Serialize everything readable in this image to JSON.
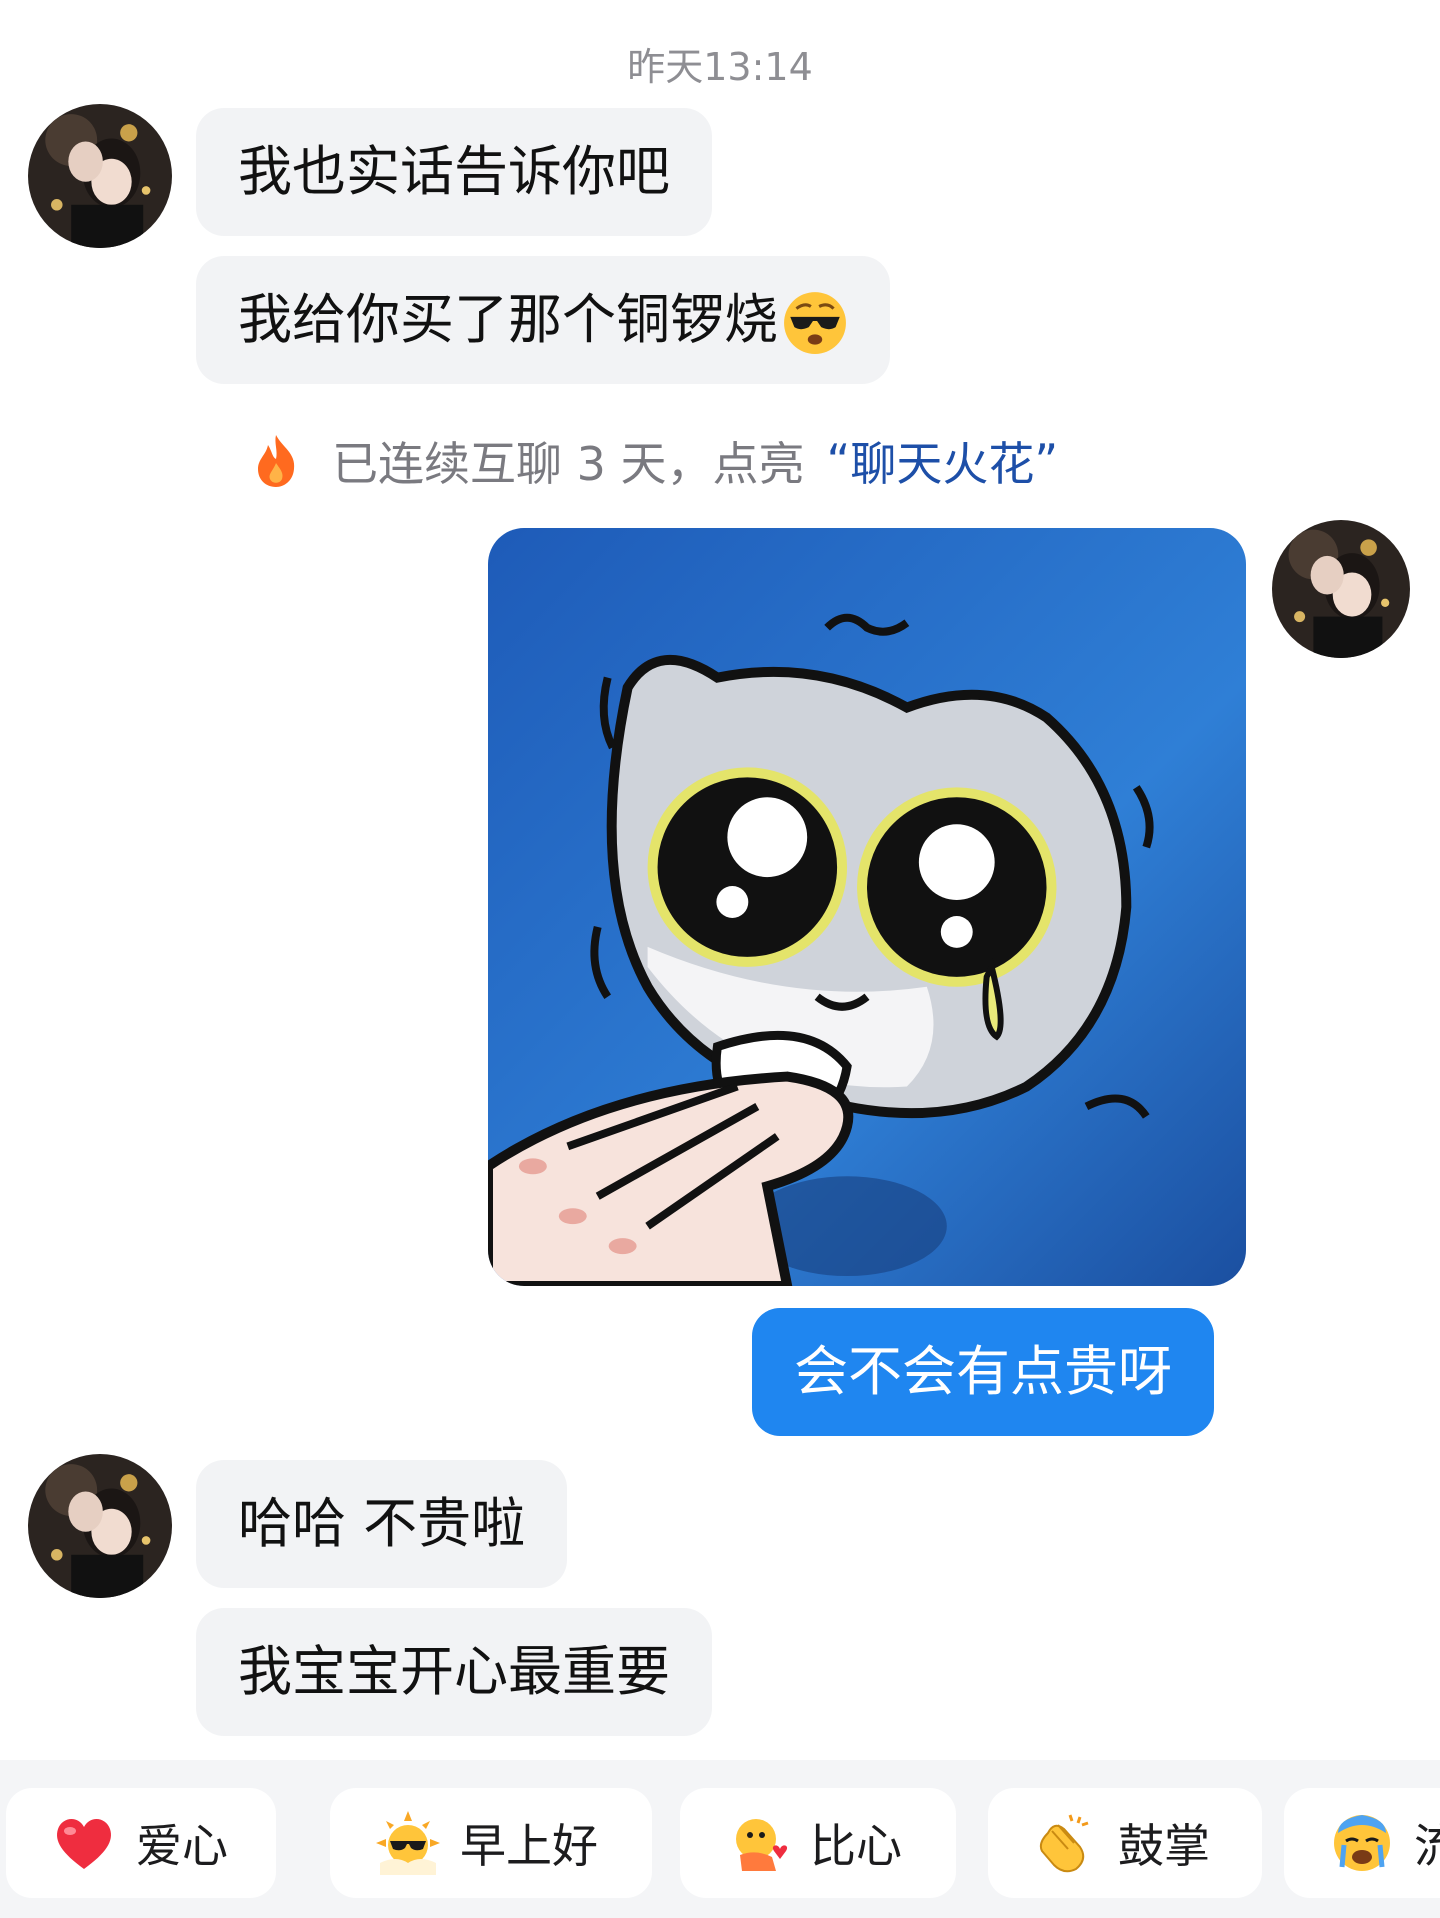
{
  "timestamp": "昨天13:14",
  "messages": [
    {
      "text": "我也实话告诉你吧"
    },
    {
      "text": "我给你买了那个铜锣烧",
      "emoji": "sunglasses-emoji"
    },
    {
      "text": "会不会有点贵呀"
    },
    {
      "text": "哈哈 不贵啦"
    },
    {
      "text": "我宝宝开心最重要"
    }
  ],
  "notice": {
    "icon": "flame-icon",
    "prefix": "已连续互聊 3 天，点亮",
    "open_quote": "“",
    "link": "聊天火花",
    "close_quote": "”"
  },
  "colors": {
    "outgoing_bubble": "#1f86f0",
    "incoming_bubble": "#f2f3f5",
    "notice_link": "#1d4fa8",
    "quickbar_bg": "#f4f5f7"
  },
  "quick_replies": [
    {
      "label": "爱心",
      "icon": "heart-icon"
    },
    {
      "label": "早上好",
      "icon": "sun-sunglasses-icon"
    },
    {
      "label": "比心",
      "icon": "finger-heart-icon"
    },
    {
      "label": "鼓掌",
      "icon": "clapping-hands-icon"
    },
    {
      "label": "流",
      "icon": "crying-face-icon"
    }
  ]
}
